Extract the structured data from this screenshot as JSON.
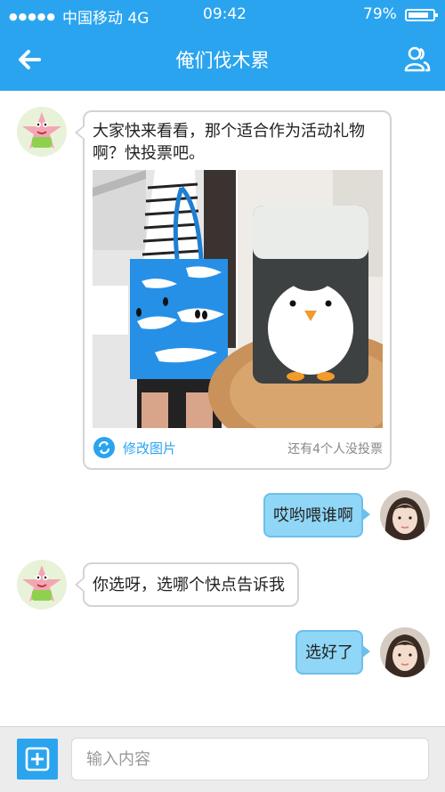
{
  "status_bar": {
    "signal": "●●●●●",
    "carrier": "中国移动 4G",
    "time": "09:42",
    "battery": "79%"
  },
  "header": {
    "title": "俺们伐木累",
    "back_icon": "arrow-left-icon",
    "members_icon": "group-users-icon"
  },
  "colors": {
    "accent": "#2aa4ef",
    "bubble_self": "#90d6f6",
    "bubble_self_border": "#6cbfea",
    "bottom_bar": "#ececec"
  },
  "messages": [
    {
      "side": "left",
      "avatar": "patrick-star-avatar",
      "text": "大家快来看看，那个适合作为活动礼物啊？快投票吧。",
      "poll": {
        "images": [
          "penguin-tote-bag",
          "penguin-glass-cup"
        ],
        "edit_label": "修改图片",
        "remaining": "还有4个人没投票"
      }
    },
    {
      "side": "right",
      "avatar": "girl-avatar",
      "text": "哎哟喂谁啊"
    },
    {
      "side": "left",
      "avatar": "patrick-star-avatar",
      "text": "你选呀，选哪个快点告诉我"
    },
    {
      "side": "right",
      "avatar": "girl-avatar",
      "text": "选好了"
    }
  ],
  "composer": {
    "plus_icon": "plus-square-icon",
    "placeholder": "输入内容"
  }
}
